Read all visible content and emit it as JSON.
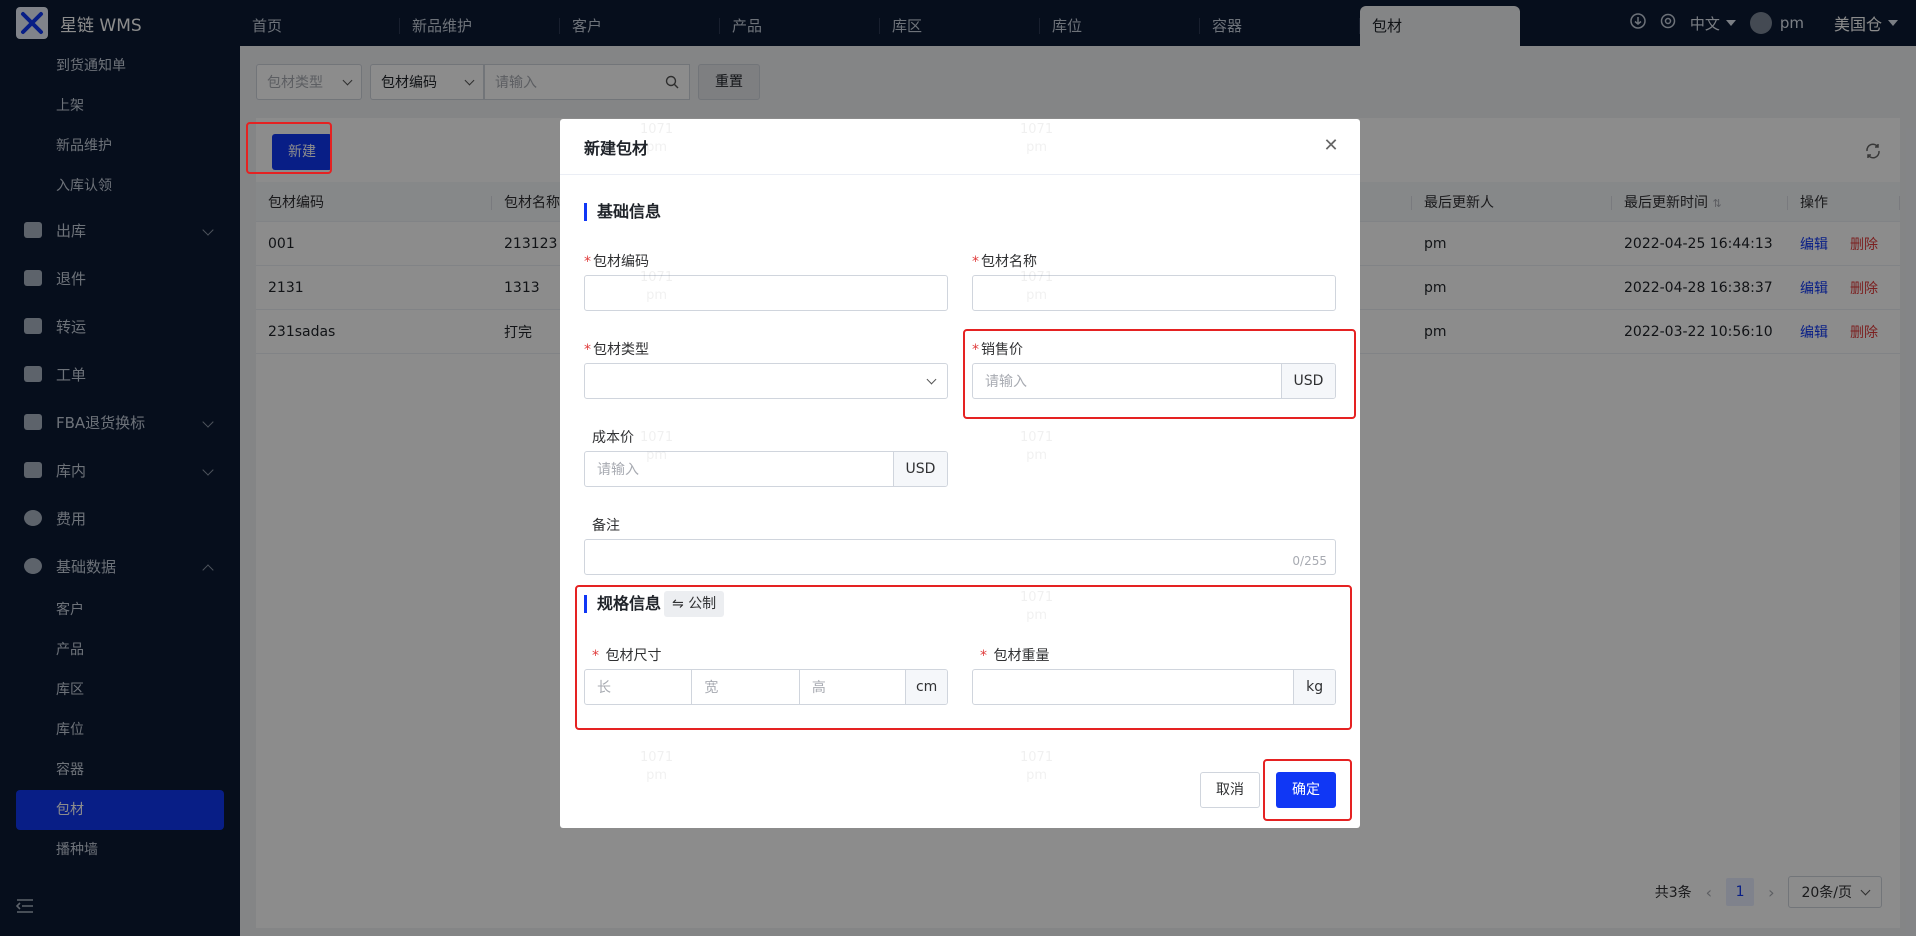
{
  "brand": {
    "name": "星链 WMS"
  },
  "tabs": [
    "首页",
    "新品维护",
    "客户",
    "产品",
    "库区",
    "库位",
    "容器",
    "包材"
  ],
  "header": {
    "lang": "中文",
    "user": "pm",
    "warehouse": "美国仓"
  },
  "sidebar": {
    "top_items": [
      "到货通知单",
      "上架",
      "新品维护",
      "入库认领"
    ],
    "groups": [
      {
        "label": "出库",
        "expandable": true
      },
      {
        "label": "退件",
        "expandable": false
      },
      {
        "label": "转运",
        "expandable": false
      },
      {
        "label": "工单",
        "expandable": false
      },
      {
        "label": "FBA退货换标",
        "expandable": true
      },
      {
        "label": "库内",
        "expandable": true
      },
      {
        "label": "费用",
        "expandable": false
      },
      {
        "label": "基础数据",
        "expandable": true
      }
    ],
    "basic_items": [
      "客户",
      "产品",
      "库区",
      "库位",
      "容器",
      "包材",
      "播种墙"
    ]
  },
  "filters": {
    "type_placeholder": "包材类型",
    "code_select": "包材编码",
    "search_placeholder": "请输入",
    "reset": "重置"
  },
  "toolbar": {
    "new_label": "新建"
  },
  "table": {
    "headers": [
      "包材编码",
      "包材名称",
      "最后更新人",
      "最后更新时间",
      "操作"
    ],
    "edit_label": "编辑",
    "delete_label": "删除",
    "rows": [
      {
        "code": "001",
        "name": "213123",
        "updater": "pm",
        "time": "2022-04-25 16:44:13"
      },
      {
        "code": "2131",
        "name": "1313",
        "updater": "pm",
        "time": "2022-04-28 16:38:37"
      },
      {
        "code": "231sadas",
        "name": "打完",
        "updater": "pm",
        "time": "2022-03-22 10:56:10"
      }
    ]
  },
  "pagination": {
    "total": "共3条",
    "current": "1",
    "size": "20条/页"
  },
  "modal": {
    "title": "新建包材",
    "basic_section": "基础信息",
    "code_label": "包材编码",
    "name_label": "包材名称",
    "type_label": "包材类型",
    "sale_price_label": "销售价",
    "sale_price_placeholder": "请输入",
    "sale_currency": "USD",
    "cost_price_label": "成本价",
    "cost_price_placeholder": "请输入",
    "cost_currency": "USD",
    "remark_label": "备注",
    "remark_counter": "0/255",
    "spec_section": "规格信息",
    "metric_toggle": "公制",
    "size_label": "包材尺寸",
    "length_placeholder": "长",
    "width_placeholder": "宽",
    "height_placeholder": "高",
    "size_unit": "cm",
    "weight_label": "包材重量",
    "weight_unit": "kg",
    "cancel": "取消",
    "confirm": "确定"
  },
  "watermark": {
    "line1": "1071",
    "line2": "pm"
  },
  "colors": {
    "primary": "#1037f5",
    "sidebar_bg": "#0b1a33",
    "danger": "#e03b3b",
    "highlight": "#e52222"
  }
}
